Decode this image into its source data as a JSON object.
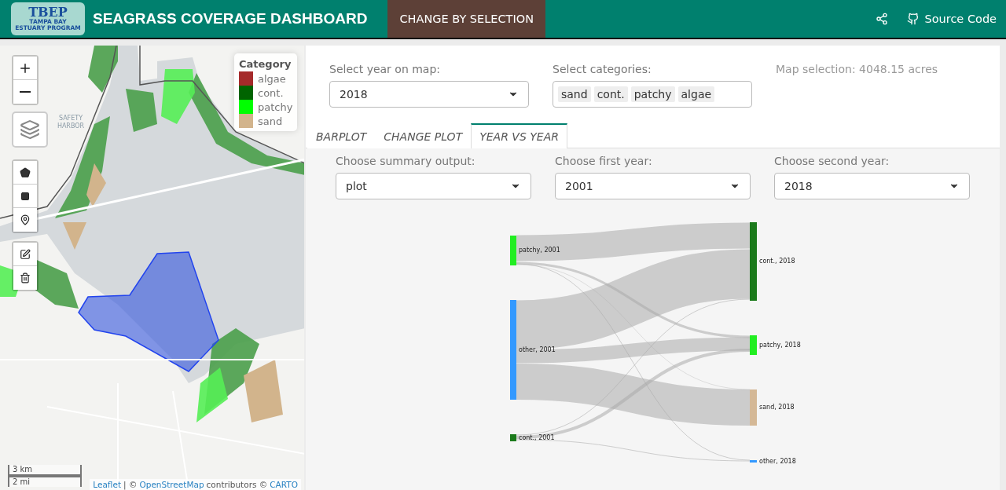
{
  "header": {
    "logo": {
      "title": "TBEP",
      "subtitle": "TAMPA BAY ESTUARY PROGRAM"
    },
    "title": "SEAGRASS COVERAGE DASHBOARD",
    "nav": [
      {
        "label": "CHANGE BY SELECTION",
        "selected": true
      }
    ],
    "source_link": "Source Code"
  },
  "map": {
    "legend": {
      "title": "Category",
      "items": [
        {
          "label": "algae",
          "color": "#a52a2a"
        },
        {
          "label": "cont.",
          "color": "#006400"
        },
        {
          "label": "patchy",
          "color": "#00ff00"
        },
        {
          "label": "sand",
          "color": "#d2b48c"
        }
      ]
    },
    "scale": [
      "3 km",
      "2 mi"
    ],
    "attribution": [
      {
        "kind": "link",
        "text": "Leaflet"
      },
      {
        "kind": "text",
        "text": "| ©"
      },
      {
        "kind": "link",
        "text": "OpenStreetMap"
      },
      {
        "kind": "text",
        "text": "contributors ©"
      },
      {
        "kind": "link",
        "text": "CARTO"
      }
    ],
    "place_label": "SAFETY HARBOR"
  },
  "controls": {
    "year": {
      "label": "Select year on map:",
      "value": "2018"
    },
    "categories": {
      "label": "Select categories:",
      "tags": [
        "sand",
        "cont.",
        "patchy",
        "algae"
      ]
    },
    "selection_text": "Map selection: 4048.15 acres"
  },
  "tabs": [
    {
      "label": "BARPLOT",
      "selected": false
    },
    {
      "label": "CHANGE PLOT",
      "selected": false
    },
    {
      "label": "YEAR VS YEAR",
      "selected": true
    }
  ],
  "options": [
    {
      "label": "Choose summary output:",
      "value": "plot"
    },
    {
      "label": "Choose first year:",
      "value": "2001"
    },
    {
      "label": "Choose second year:",
      "value": "2018"
    }
  ],
  "sankey": {
    "left_nodes": [
      {
        "label": "patchy, 2001",
        "color": "#22ee22"
      },
      {
        "label": "other, 2001",
        "color": "#3399ff"
      },
      {
        "label": "cont., 2001",
        "color": "#1b7a1b"
      }
    ],
    "right_nodes": [
      {
        "label": "cont., 2018",
        "color": "#1b7a1b"
      },
      {
        "label": "patchy, 2018",
        "color": "#22ee22"
      },
      {
        "label": "sand, 2018",
        "color": "#d4b896"
      },
      {
        "label": "other, 2018",
        "color": "#3399ff"
      }
    ]
  }
}
